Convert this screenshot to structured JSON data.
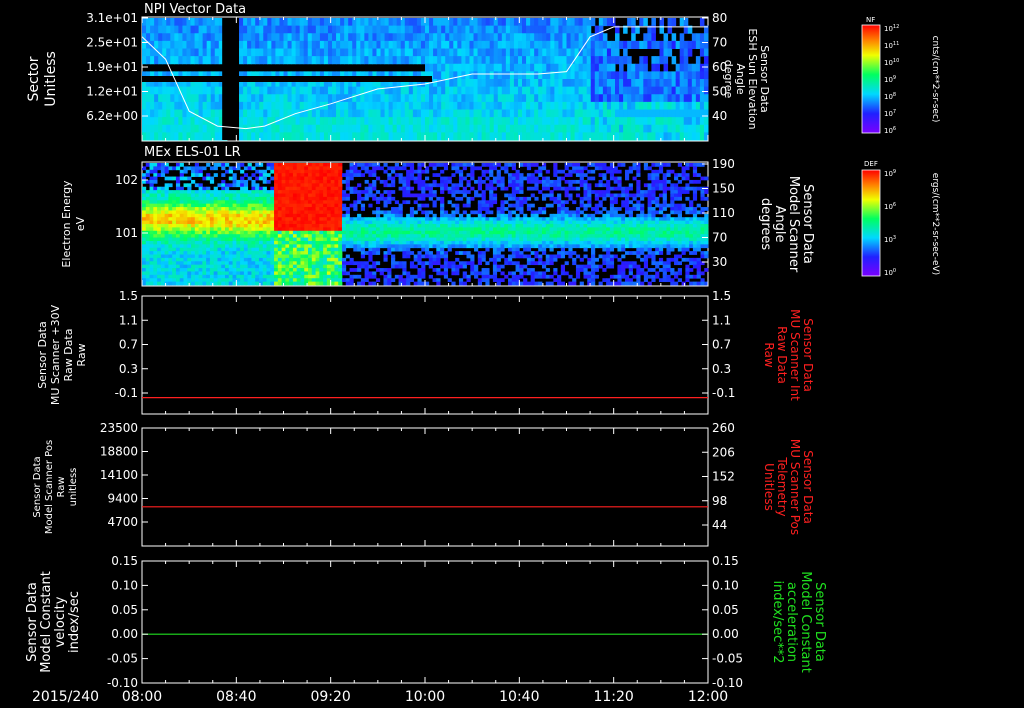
{
  "date_label": "2015/240",
  "x_axis": {
    "tick_labels": [
      "08:00",
      "08:40",
      "09:20",
      "10:00",
      "10:40",
      "11:20",
      "12:00"
    ],
    "range_minutes": [
      480,
      720
    ]
  },
  "colorbars": [
    {
      "corner_label": "NF",
      "unit": "cnts/(cm**2-sr-sec)",
      "tick_labels": [
        "10^12",
        "10^11",
        "10^10",
        "10^9",
        "10^8",
        "10^7",
        "10^6"
      ]
    },
    {
      "corner_label": "DEF",
      "unit": "ergs/(cm**2-sr-sec-eV)",
      "tick_labels": [
        "10^9",
        "10^6",
        "10^3",
        "10^0"
      ]
    }
  ],
  "chart_data": [
    {
      "type": "heatmap",
      "title": "NPI Vector Data",
      "ylabel": [
        "Sector",
        "Unitless"
      ],
      "y_tick_labels": [
        "3.1e+01",
        "2.5e+01",
        "1.9e+01",
        "1.2e+01",
        "6.2e+00"
      ],
      "right_axis": {
        "label": [
          "Sensor Data",
          "ESH Sun Elevation",
          "Angle",
          "degree"
        ],
        "ylim": [
          30,
          80
        ],
        "tick_labels": [
          "80",
          "70",
          "60",
          "50",
          "40"
        ]
      },
      "overlay_line": {
        "color": "#ffffff",
        "x_minutes": [
          480,
          490,
          500,
          512,
          524,
          532,
          545,
          560,
          580,
          600,
          620,
          630,
          640,
          648,
          660,
          670,
          680,
          700,
          720
        ],
        "values": [
          72,
          63,
          42,
          36,
          35,
          36,
          41,
          45,
          51,
          53,
          57,
          57,
          57,
          57,
          58,
          72,
          76,
          76,
          76
        ]
      }
    },
    {
      "type": "heatmap",
      "title": "MEx ELS-01 LR",
      "ylabel": [
        "Electron Energy",
        "eV"
      ],
      "y_tick_labels": [
        "10^2",
        "10^1"
      ],
      "right_axis": {
        "label": [
          "Sensor Data",
          "Model Scanner",
          "Angle",
          "degrees"
        ],
        "ylim": [
          0,
          190
        ],
        "tick_labels": [
          "190",
          "150",
          "110",
          "70",
          "30"
        ]
      }
    },
    {
      "type": "line",
      "ylabel": [
        "Sensor Data",
        "MU Scanner +30V",
        "Raw Data",
        "Raw"
      ],
      "ylim": [
        -0.3,
        1.5
      ],
      "y_tick_labels": [
        "1.5",
        "1.1",
        "0.7",
        "0.3",
        "-0.1"
      ],
      "right_axis": {
        "label": [
          "Sensor Data",
          "MU Scanner Int",
          "Raw Data",
          "Raw"
        ],
        "tick_labels": [
          "1.5",
          "1.1",
          "0.7",
          "0.3",
          "-0.1"
        ],
        "color": "#ff2020"
      },
      "series": [
        {
          "color": "#ff2020",
          "x_minutes": [
            480,
            720
          ],
          "values": [
            -0.05,
            -0.05
          ]
        }
      ]
    },
    {
      "type": "line",
      "ylabel": [
        "Sensor Data",
        "Model Scanner Pos",
        "Raw",
        "unitless"
      ],
      "ylim": [
        0,
        23500
      ],
      "y_tick_labels": [
        "23500",
        "18800",
        "14100",
        "9400",
        "4700"
      ],
      "right_axis": {
        "label": [
          "Sensor Data",
          "MU Scanner Pos",
          "Telemetry",
          "Unitless"
        ],
        "ylim": [
          0,
          260
        ],
        "tick_labels": [
          "260",
          "206",
          "152",
          "98",
          "44"
        ],
        "color": "#ff2020"
      },
      "series": [
        {
          "color": "#ff2020",
          "x_minutes": [
            480,
            720
          ],
          "values": [
            7800,
            7800
          ]
        }
      ]
    },
    {
      "type": "line",
      "ylabel": [
        "Sensor Data",
        "Model Constant",
        "velocity",
        "index/sec"
      ],
      "ylim": [
        -0.1,
        0.15
      ],
      "y_tick_labels": [
        "0.15",
        "0.10",
        "0.05",
        "0.00",
        "-0.05",
        "-0.10"
      ],
      "right_axis": {
        "label": [
          "Sensor Data",
          "Model Constant",
          "acceleration",
          "index/sec**2"
        ],
        "tick_labels": [
          "0.15",
          "0.10",
          "0.05",
          "0.00",
          "-0.05",
          "-0.10"
        ],
        "color": "#20e020"
      },
      "series": [
        {
          "color": "#20e020",
          "x_minutes": [
            480,
            720
          ],
          "values": [
            0.0,
            0.0
          ]
        }
      ]
    }
  ]
}
